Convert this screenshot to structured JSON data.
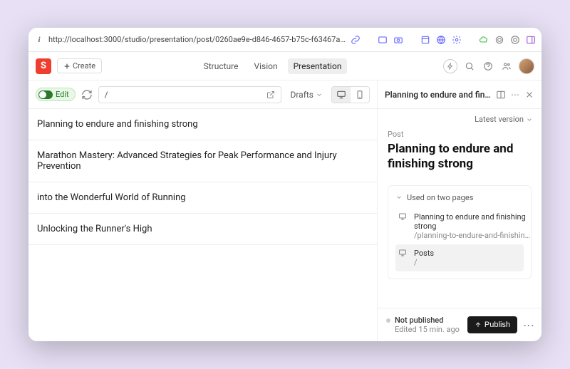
{
  "url": "http://localhost:3000/studio/presentation/post/0260ae9e-d846-4657-b75c-f63467aec9e…",
  "logo_letter": "S",
  "create_label": "Create",
  "nav": {
    "structure": "Structure",
    "vision": "Vision",
    "presentation": "Presentation"
  },
  "toolbar": {
    "edit_label": "Edit",
    "path_value": "/",
    "drafts_label": "Drafts"
  },
  "posts": [
    "Planning to endure and finishing strong",
    "Marathon Mastery: Advanced Strategies for Peak Performance and Injury Prevention",
    "into the Wonderful World of Running",
    "Unlocking the Runner's High"
  ],
  "editor": {
    "header_title": "Planning to endure and finishi…",
    "version_label": "Latest version",
    "doc_type": "Post",
    "doc_title": "Planning to endure and finishing strong",
    "used_header": "Used on two pages",
    "used_items": [
      {
        "title": "Planning to endure and finishing strong",
        "path": "/planning-to-endure-and-finishin…",
        "active": false
      },
      {
        "title": "Posts",
        "path": "/",
        "active": true
      }
    ],
    "publish_status": "Not published",
    "publish_time": "Edited 15 min. ago",
    "publish_btn": "Publish"
  }
}
